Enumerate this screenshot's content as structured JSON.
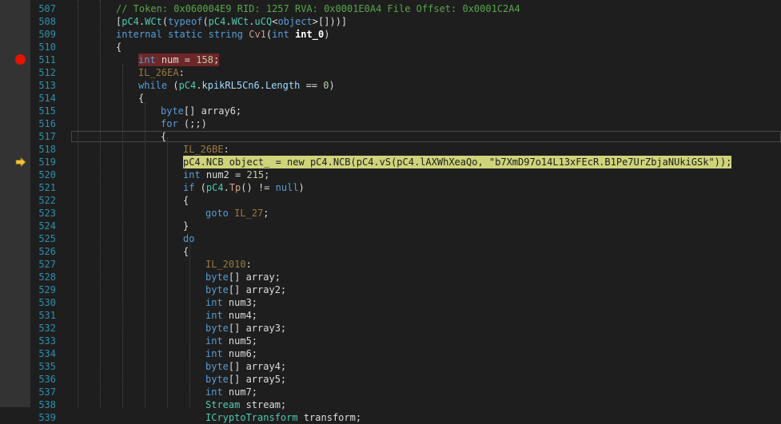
{
  "editor": {
    "lines": [
      {
        "n": "507",
        "indent": 2,
        "tokens": [
          {
            "t": "// Token: 0x060004E9 RID: 1257 RVA: 0x0001E0A4 File Offset: 0x0001C2A4",
            "c": "cm"
          }
        ]
      },
      {
        "n": "508",
        "indent": 2,
        "tokens": [
          {
            "t": "["
          },
          {
            "t": "pC4",
            "c": "ty"
          },
          {
            "t": "."
          },
          {
            "t": "WCt",
            "c": "ty"
          },
          {
            "t": "("
          },
          {
            "t": "typeof",
            "c": "kw"
          },
          {
            "t": "("
          },
          {
            "t": "pC4",
            "c": "ty"
          },
          {
            "t": "."
          },
          {
            "t": "WCt",
            "c": "ty"
          },
          {
            "t": "."
          },
          {
            "t": "uCQ",
            "c": "ty"
          },
          {
            "t": "<"
          },
          {
            "t": "object",
            "c": "kw"
          },
          {
            "t": ">[]))]"
          }
        ]
      },
      {
        "n": "509",
        "indent": 2,
        "tokens": [
          {
            "t": "internal",
            "c": "kw"
          },
          {
            "t": " "
          },
          {
            "t": "static",
            "c": "kw"
          },
          {
            "t": " "
          },
          {
            "t": "string",
            "c": "kw"
          },
          {
            "t": " "
          },
          {
            "t": "Cv1",
            "c": "str"
          },
          {
            "t": "("
          },
          {
            "t": "int",
            "c": "kw"
          },
          {
            "t": " "
          },
          {
            "t": "int_0",
            "c": "plain-bold"
          },
          {
            "t": ")"
          }
        ]
      },
      {
        "n": "510",
        "indent": 2,
        "tokens": [
          {
            "t": "{"
          }
        ]
      },
      {
        "n": "511",
        "indent": 3,
        "hl": "bp",
        "tokens": [
          {
            "t": "int",
            "c": "kw"
          },
          {
            "t": " num = "
          },
          {
            "t": "158",
            "c": "num"
          },
          {
            "t": ";"
          }
        ]
      },
      {
        "n": "512",
        "indent": 3,
        "tokens": [
          {
            "t": "IL_26EA",
            "c": "lbl"
          },
          {
            "t": ":"
          }
        ]
      },
      {
        "n": "513",
        "indent": 3,
        "tokens": [
          {
            "t": "while",
            "c": "kw"
          },
          {
            "t": " ("
          },
          {
            "t": "pC4",
            "c": "ty"
          },
          {
            "t": "."
          },
          {
            "t": "kpikRL5Cn6",
            "c": "fld"
          },
          {
            "t": "."
          },
          {
            "t": "Length",
            "c": "fld"
          },
          {
            "t": " == "
          },
          {
            "t": "0",
            "c": "num"
          },
          {
            "t": ")"
          }
        ]
      },
      {
        "n": "514",
        "indent": 3,
        "tokens": [
          {
            "t": "{"
          }
        ]
      },
      {
        "n": "515",
        "indent": 4,
        "tokens": [
          {
            "t": "byte",
            "c": "kw"
          },
          {
            "t": "[] array6;"
          }
        ]
      },
      {
        "n": "516",
        "indent": 4,
        "tokens": [
          {
            "t": "for",
            "c": "kw"
          },
          {
            "t": " (;;)"
          }
        ]
      },
      {
        "n": "517",
        "indent": 4,
        "box": true,
        "tokens": [
          {
            "t": "{"
          }
        ]
      },
      {
        "n": "518",
        "indent": 5,
        "tokens": [
          {
            "t": "IL_26BE",
            "c": "lbl"
          },
          {
            "t": ":"
          }
        ]
      },
      {
        "n": "519",
        "indent": 5,
        "hl": "cur",
        "tokens": [
          {
            "t": "pC4.NCB object_ = new pC4.NCB(pC4.vS(pC4.lAXWhXeaQo, \"b7XmD97o14L13xFEcR.B1Pe7UrZbjaNUkiGSk\"));"
          }
        ]
      },
      {
        "n": "520",
        "indent": 5,
        "tokens": [
          {
            "t": "int",
            "c": "kw"
          },
          {
            "t": " num2 = "
          },
          {
            "t": "215",
            "c": "num"
          },
          {
            "t": ";"
          }
        ]
      },
      {
        "n": "521",
        "indent": 5,
        "tokens": [
          {
            "t": "if",
            "c": "kw"
          },
          {
            "t": " ("
          },
          {
            "t": "pC4",
            "c": "ty"
          },
          {
            "t": "."
          },
          {
            "t": "Tp",
            "c": "str"
          },
          {
            "t": "() != "
          },
          {
            "t": "null",
            "c": "kw"
          },
          {
            "t": ")"
          }
        ]
      },
      {
        "n": "522",
        "indent": 5,
        "tokens": [
          {
            "t": "{"
          }
        ]
      },
      {
        "n": "523",
        "indent": 6,
        "tokens": [
          {
            "t": "goto",
            "c": "kw"
          },
          {
            "t": " "
          },
          {
            "t": "IL_27",
            "c": "lbl"
          },
          {
            "t": ";"
          }
        ]
      },
      {
        "n": "524",
        "indent": 5,
        "tokens": [
          {
            "t": "}"
          }
        ]
      },
      {
        "n": "525",
        "indent": 5,
        "tokens": [
          {
            "t": "do",
            "c": "kw"
          }
        ]
      },
      {
        "n": "526",
        "indent": 5,
        "tokens": [
          {
            "t": "{"
          }
        ]
      },
      {
        "n": "527",
        "indent": 6,
        "tokens": [
          {
            "t": "IL_2010",
            "c": "lbl"
          },
          {
            "t": ":"
          }
        ]
      },
      {
        "n": "528",
        "indent": 6,
        "tokens": [
          {
            "t": "byte",
            "c": "kw"
          },
          {
            "t": "[] array;"
          }
        ]
      },
      {
        "n": "529",
        "indent": 6,
        "tokens": [
          {
            "t": "byte",
            "c": "kw"
          },
          {
            "t": "[] array2;"
          }
        ]
      },
      {
        "n": "530",
        "indent": 6,
        "tokens": [
          {
            "t": "int",
            "c": "kw"
          },
          {
            "t": " num3;"
          }
        ]
      },
      {
        "n": "531",
        "indent": 6,
        "tokens": [
          {
            "t": "int",
            "c": "kw"
          },
          {
            "t": " num4;"
          }
        ]
      },
      {
        "n": "532",
        "indent": 6,
        "tokens": [
          {
            "t": "byte",
            "c": "kw"
          },
          {
            "t": "[] array3;"
          }
        ]
      },
      {
        "n": "533",
        "indent": 6,
        "tokens": [
          {
            "t": "int",
            "c": "kw"
          },
          {
            "t": " num5;"
          }
        ]
      },
      {
        "n": "534",
        "indent": 6,
        "tokens": [
          {
            "t": "int",
            "c": "kw"
          },
          {
            "t": " num6;"
          }
        ]
      },
      {
        "n": "535",
        "indent": 6,
        "tokens": [
          {
            "t": "byte",
            "c": "kw"
          },
          {
            "t": "[] array4;"
          }
        ]
      },
      {
        "n": "536",
        "indent": 6,
        "tokens": [
          {
            "t": "byte",
            "c": "kw"
          },
          {
            "t": "[] array5;"
          }
        ]
      },
      {
        "n": "537",
        "indent": 6,
        "tokens": [
          {
            "t": "int",
            "c": "kw"
          },
          {
            "t": " num7;"
          }
        ]
      },
      {
        "n": "538",
        "indent": 6,
        "tokens": [
          {
            "t": "Stream",
            "c": "ty"
          },
          {
            "t": " stream;"
          }
        ]
      },
      {
        "n": "539",
        "indent": 6,
        "tokens": [
          {
            "t": "ICryptoTransform",
            "c": "ty"
          },
          {
            "t": " transform;"
          }
        ]
      }
    ]
  },
  "glyphs": {
    "breakpoint_line": "511",
    "current_line": "519"
  },
  "colors": {
    "keyword": "#569cd6",
    "type": "#4ec9b0",
    "comment": "#57a64a",
    "breakpoint": "#e51400",
    "current": "#cfd47a"
  }
}
